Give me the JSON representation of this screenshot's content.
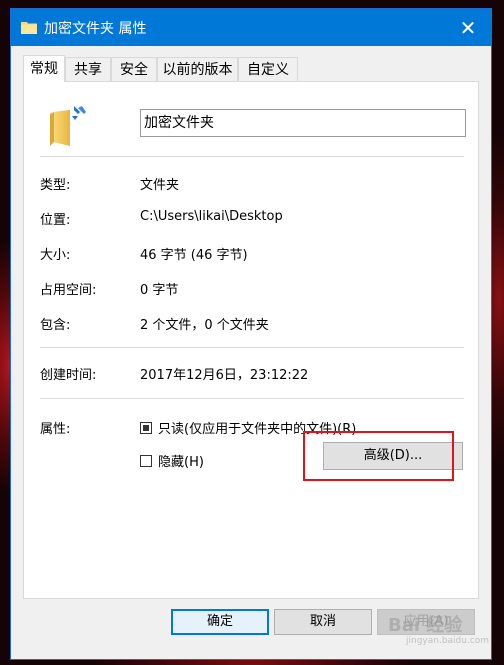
{
  "window": {
    "title": "加密文件夹 属性",
    "close_label": "✕"
  },
  "tabs": [
    {
      "label": "常规"
    },
    {
      "label": "共享"
    },
    {
      "label": "安全"
    },
    {
      "label": "以前的版本"
    },
    {
      "label": "自定义"
    }
  ],
  "general": {
    "folder_name": "加密文件夹",
    "rows": [
      {
        "label": "类型:",
        "value": "文件夹"
      },
      {
        "label": "位置:",
        "value": "C:\\Users\\likai\\Desktop"
      },
      {
        "label": "大小:",
        "value": "46 字节 (46 字节)"
      },
      {
        "label": "占用空间:",
        "value": "0 字节"
      },
      {
        "label": "包含:",
        "value": "2 个文件，0 个文件夹"
      }
    ],
    "created_label": "创建时间:",
    "created_value": "2017年12月6日，23:12:22",
    "attributes_label": "属性:",
    "readonly_label": "只读(仅应用于文件夹中的文件)(R)",
    "readonly_state": "indeterminate",
    "hidden_label": "隐藏(H)",
    "hidden_checked": false,
    "advanced_button": "高级(D)..."
  },
  "footer": {
    "ok": "确定",
    "cancel": "取消",
    "apply": "应用(A)"
  },
  "watermark": {
    "text": "Bai 经验",
    "sub": "jingyan.baidu.com"
  },
  "colors": {
    "titlebar": "#0078d7",
    "highlight": "#e0141c"
  }
}
